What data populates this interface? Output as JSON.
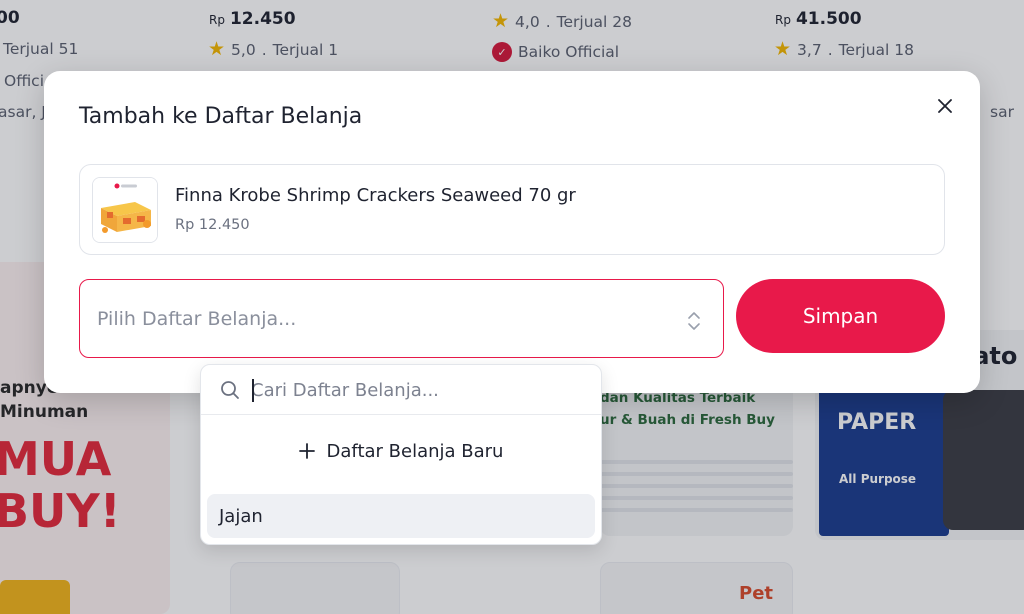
{
  "background": {
    "products": [
      {
        "price": "00",
        "rating": "",
        "sold": "Terjual 51",
        "store": "Offici",
        "extra": "asar, J"
      },
      {
        "price": "12.450",
        "price_prefix": "Rp",
        "rating": "5,0",
        "sold": "Terjual 1"
      },
      {
        "price": "",
        "rating": "4,0",
        "sold": "Terjual 28",
        "store": "Baiko Official"
      },
      {
        "price": "41.500",
        "price_prefix": "Rp",
        "rating": "3,7",
        "sold": "Terjual 18"
      }
    ],
    "side_fragment": "sar",
    "banners": {
      "left_lines": [
        "apnye",
        "Minuman",
        "MUA",
        "BUY!"
      ],
      "middle_lines": [
        "dan Kualitas Terbaik",
        "ur & Buah di Fresh Buy"
      ],
      "right_heading": "lato",
      "paper_brand": "PAPER",
      "paper_sub": "All Purpose",
      "pet_logo": "Pet"
    },
    "separator": "."
  },
  "modal": {
    "title": "Tambah ke Daftar Belanja",
    "product": {
      "name": "Finna Krobe Shrimp Crackers Seaweed 70 gr",
      "price": "Rp 12.450"
    },
    "select_placeholder": "Pilih Daftar Belanja...",
    "save_label": "Simpan"
  },
  "dropdown": {
    "search_placeholder": "Cari Daftar Belanja...",
    "new_list_label": "Daftar Belanja Baru",
    "items": [
      {
        "label": "Jajan"
      }
    ]
  },
  "colors": {
    "accent": "#e8194a",
    "star": "#f5b800",
    "official_badge": "#d7193b",
    "overlay": "rgba(24,28,40,0.22)",
    "promo_red": "#e52a3b"
  }
}
